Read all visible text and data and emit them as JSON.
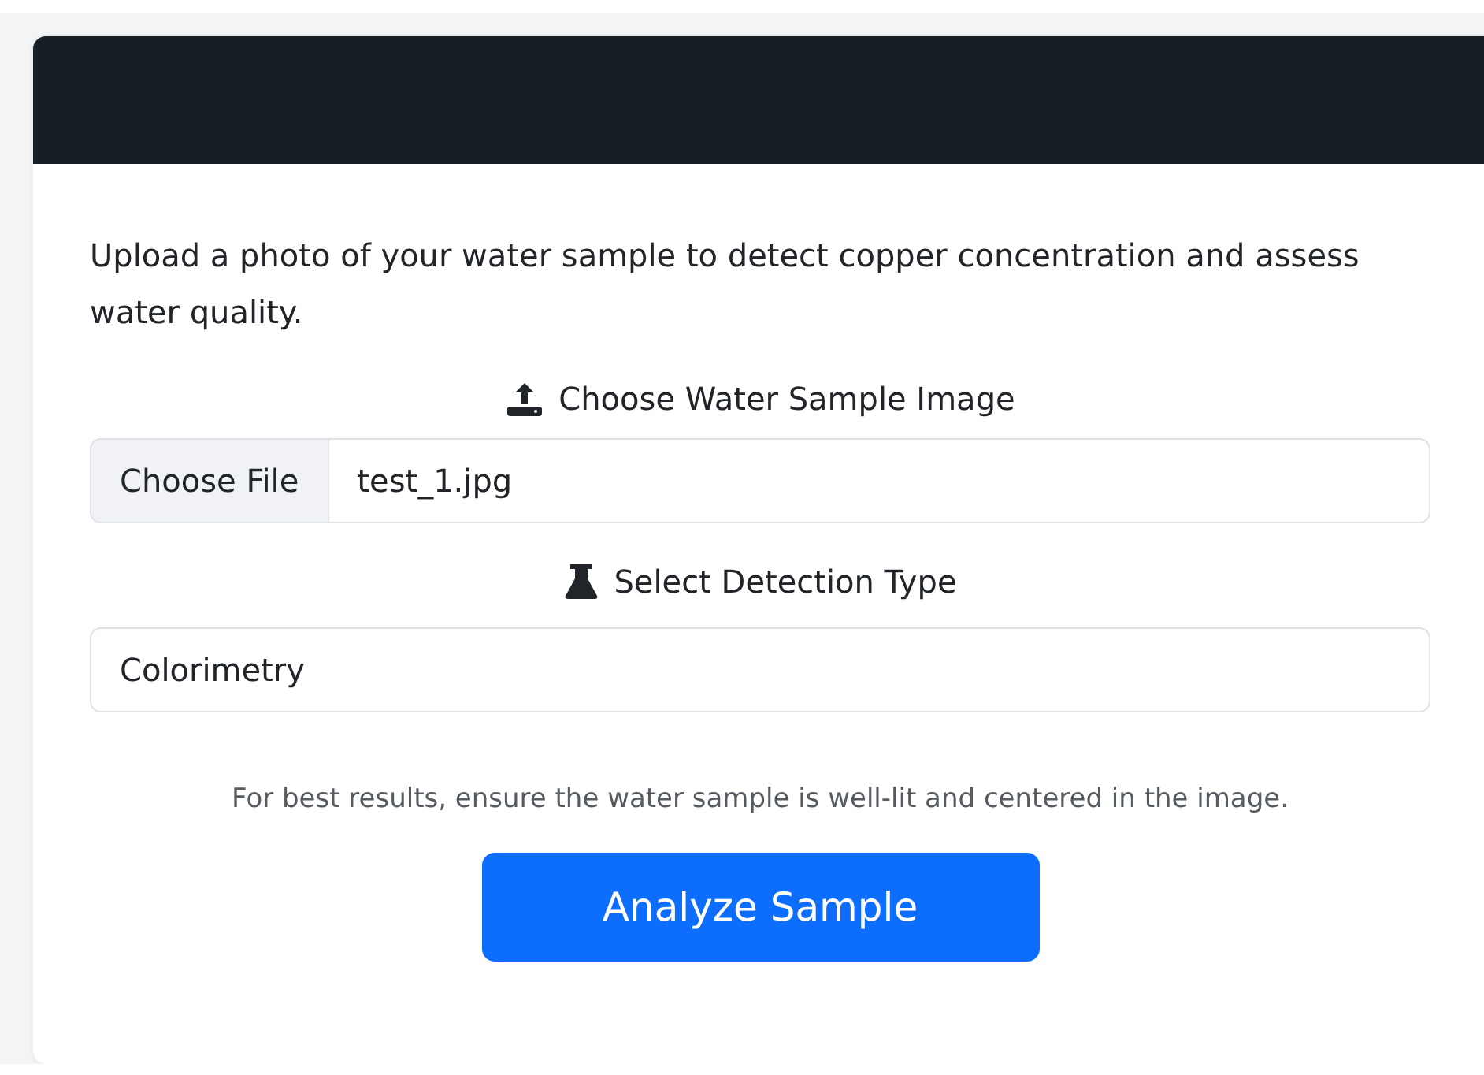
{
  "description": "Upload a photo of your water sample to detect copper concentration and assess water quality.",
  "file_input": {
    "label": "Choose Water Sample Image",
    "button": "Choose File",
    "value": "test_1.jpg"
  },
  "detection_type": {
    "label": "Select Detection Type",
    "value": "Colorimetry"
  },
  "hint": "For best results, ensure the water sample is well-lit and centered in the image.",
  "submit_button": "Analyze Sample"
}
